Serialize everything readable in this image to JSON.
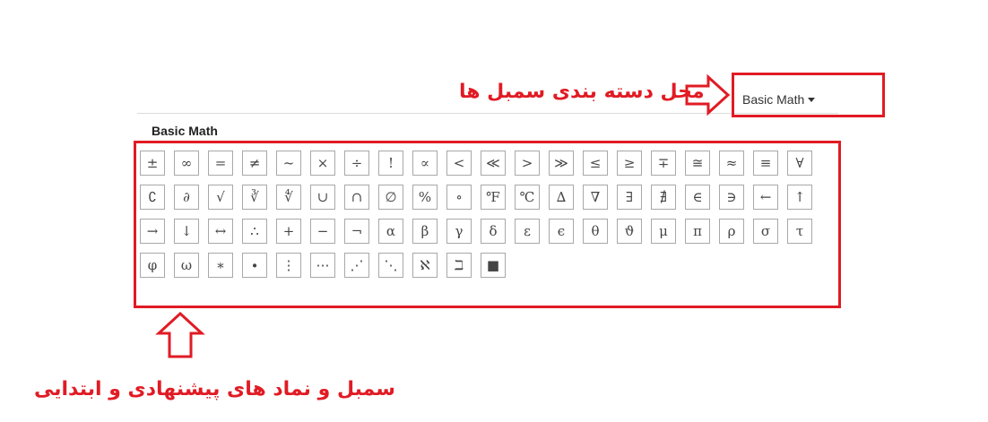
{
  "category_select": {
    "selected": "Basic Math"
  },
  "section": {
    "title": "Basic Math"
  },
  "symbols": [
    "±",
    "∞",
    "=",
    "≠",
    "~",
    "×",
    "÷",
    "!",
    "∝",
    "<",
    "≪",
    ">",
    "≫",
    "≤",
    "≥",
    "∓",
    "≅",
    "≈",
    "≡",
    "∀",
    "∁",
    "∂",
    "√",
    "∛",
    "∜",
    "∪",
    "∩",
    "∅",
    "%",
    "∘",
    "℉",
    "℃",
    "∆",
    "∇",
    "∃",
    "∄",
    "∈",
    "∋",
    "←",
    "↑",
    "→",
    "↓",
    "↔",
    "∴",
    "+",
    "−",
    "¬",
    "α",
    "β",
    "γ",
    "δ",
    "ε",
    "ϵ",
    "θ",
    "ϑ",
    "μ",
    "π",
    "ρ",
    "σ",
    "τ",
    "φ",
    "ω",
    "∗",
    "∙",
    "⋮",
    "⋯",
    "⋰",
    "⋱",
    "ℵ",
    "ℶ",
    "■"
  ],
  "annotations": {
    "category_location": "محل دسته بندی سمبل ها",
    "suggested_symbols": "سمبل و نماد های پیشنهادی و ابتدایی"
  },
  "colors": {
    "annotation_red": "#e11b24",
    "button_border": "#a8a8a8",
    "text": "#444444"
  }
}
